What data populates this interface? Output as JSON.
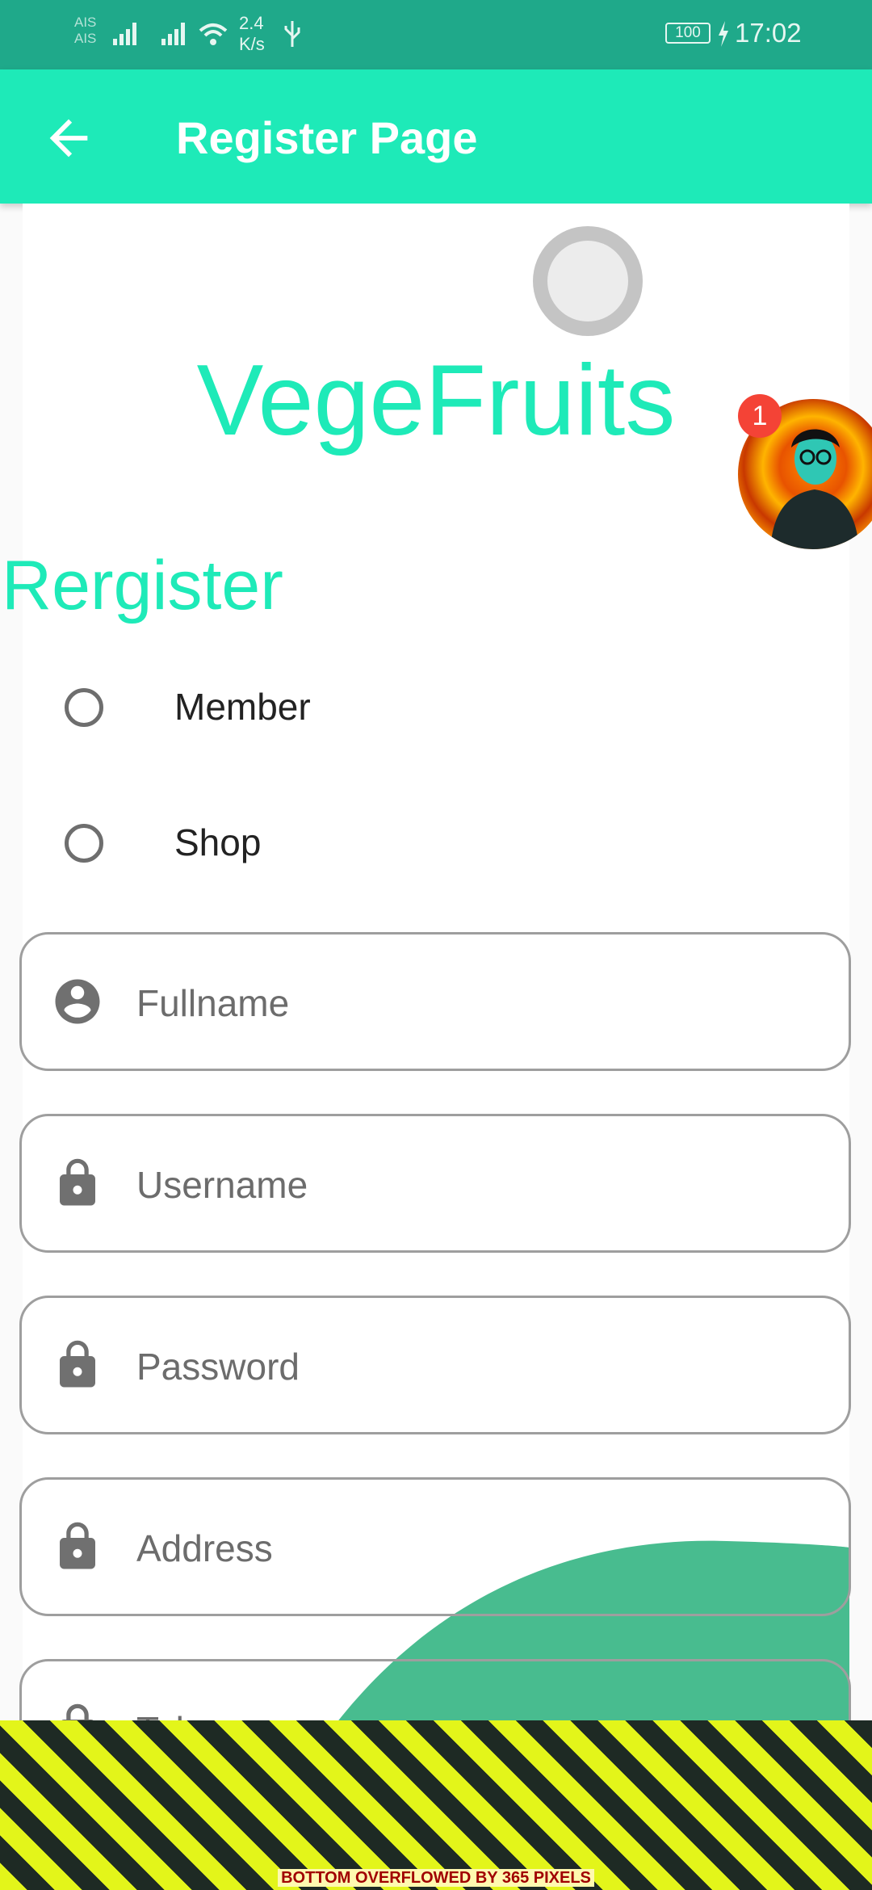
{
  "status_bar": {
    "carrier_1": "AIS",
    "carrier_2": "AIS",
    "net_speed_value": "2.4",
    "net_speed_unit": "K/s",
    "battery": "100",
    "time": "17:02",
    "background": "#1fa98a"
  },
  "app_bar": {
    "title": "Register Page",
    "back_icon": "arrow-left-icon",
    "background": "#1eeab8"
  },
  "brand": {
    "name": "VegeFruits",
    "color": "#1eeab8"
  },
  "chat_head": {
    "badge_count": "1"
  },
  "form": {
    "section_title": "Rergister",
    "role_options": [
      {
        "label": "Member",
        "selected": false
      },
      {
        "label": "Shop",
        "selected": false
      }
    ],
    "fields": [
      {
        "placeholder": "Fullname",
        "icon": "account-circle-icon"
      },
      {
        "placeholder": "Username",
        "icon": "lock-icon"
      },
      {
        "placeholder": "Password",
        "icon": "lock-icon"
      },
      {
        "placeholder": "Address",
        "icon": "lock-icon"
      },
      {
        "placeholder": "Tel",
        "icon": "lock-icon"
      }
    ]
  },
  "debug": {
    "overflow_message": "BOTTOM OVERFLOWED BY 365 PIXELS"
  }
}
